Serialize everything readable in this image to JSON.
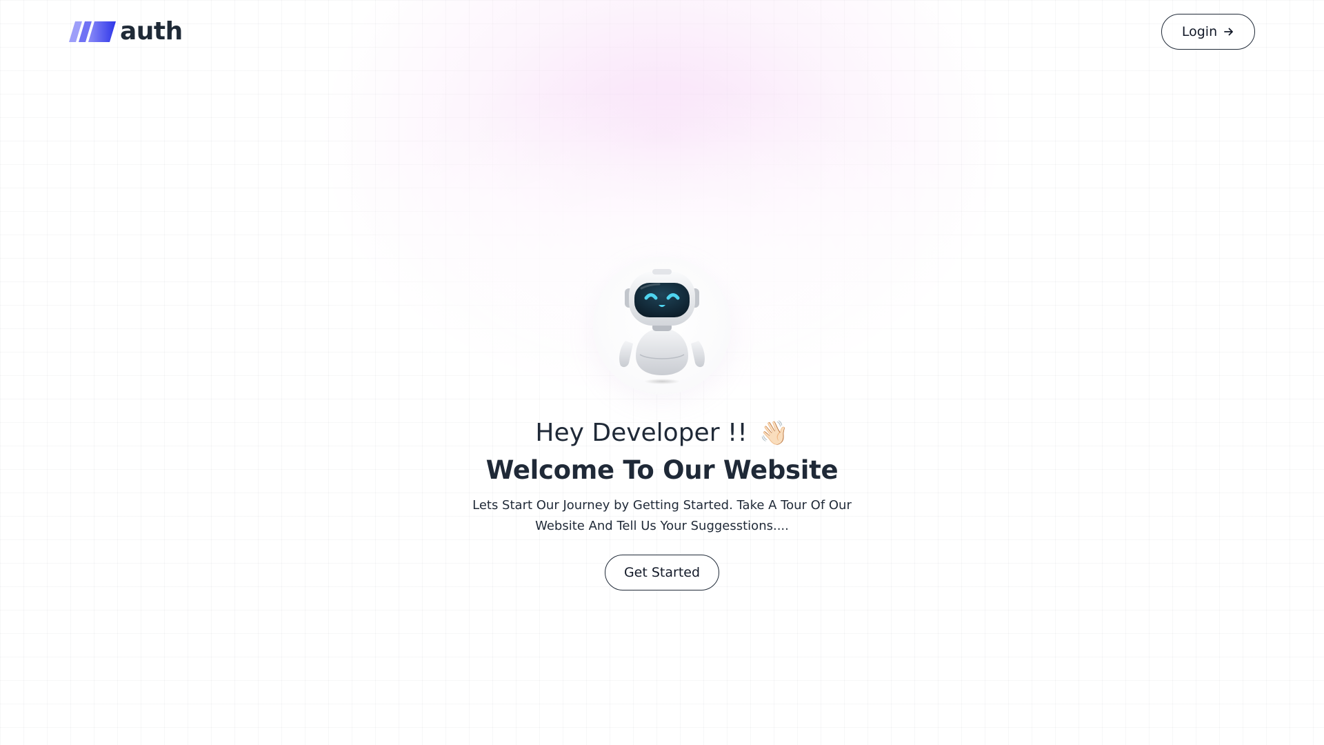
{
  "header": {
    "logo_text": "auth",
    "logo_icon": "slanted-bars-icon",
    "login_label": "Login",
    "login_icon": "arrow-right-icon"
  },
  "hero": {
    "avatar_icon": "robot-icon",
    "greeting": "Hey Developer !!",
    "greeting_emoji": "👋🏻",
    "title": "Welcome To Our Website",
    "subtitle": "Lets Start Our Journey by Getting Started. Take A Tour Of Our Website And Tell Us Your Suggesstions....",
    "cta_label": "Get Started"
  },
  "colors": {
    "logo_gradient_start": "#8b8cf8",
    "logo_gradient_end": "#2d35e8",
    "text": "#1f2937",
    "glow": "#f6d6f6",
    "robot_visor": "#0f2433",
    "robot_eyes": "#4fd4ef"
  }
}
